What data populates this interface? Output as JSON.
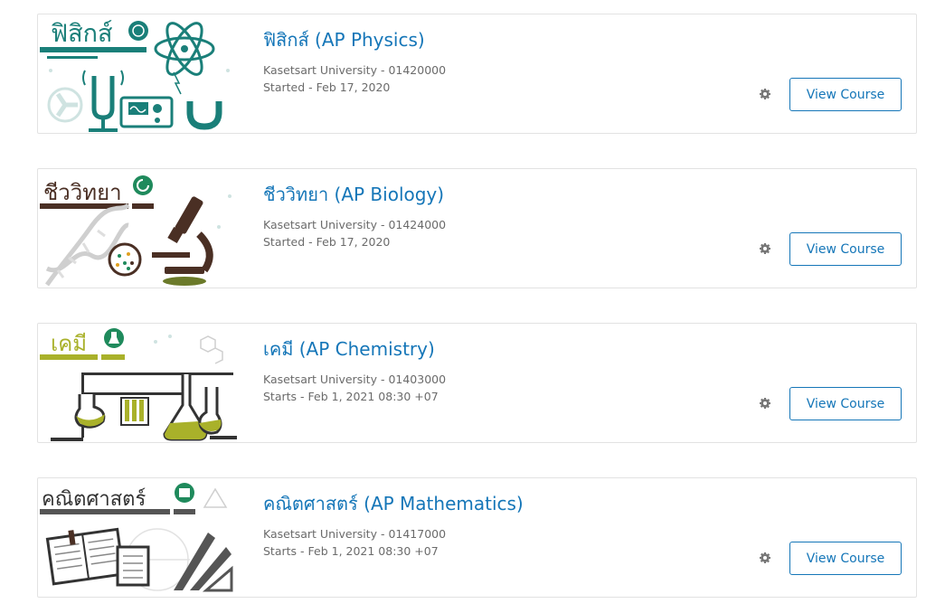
{
  "courses": [
    {
      "title": "ฟิสิกส์ (AP Physics)",
      "org_line": "Kasetsart University - 01420000",
      "date_line": "Started - Feb 17, 2020",
      "thumb_label": "ฟิสิกส์",
      "accent": "#1a7f79",
      "view_label": "View Course"
    },
    {
      "title": "ชีววิทยา (AP Biology)",
      "org_line": "Kasetsart University - 01424000",
      "date_line": "Started - Feb 17, 2020",
      "thumb_label": "ชีววิทยา",
      "accent": "#4a2f24",
      "view_label": "View Course"
    },
    {
      "title": "เคมี (AP Chemistry)",
      "org_line": "Kasetsart University - 01403000",
      "date_line": "Starts - Feb 1, 2021 08:30 +07",
      "thumb_label": "เคมี",
      "accent": "#a9b12a",
      "view_label": "View Course"
    },
    {
      "title": "คณิตศาสตร์ (AP Mathematics)",
      "org_line": "Kasetsart University - 01417000",
      "date_line": "Starts - Feb 1, 2021 08:30 +07",
      "thumb_label": "คณิตศาสตร์",
      "accent": "#555555",
      "view_label": "View Course"
    }
  ],
  "icons": {
    "settings": "gear-icon",
    "badge": "science-badge-icon"
  },
  "colors": {
    "link": "#1576b8",
    "meta_text": "#6b6b6b",
    "card_border": "#e2e2e2",
    "gear": "#777777",
    "badge_green": "#1f8a5c"
  }
}
